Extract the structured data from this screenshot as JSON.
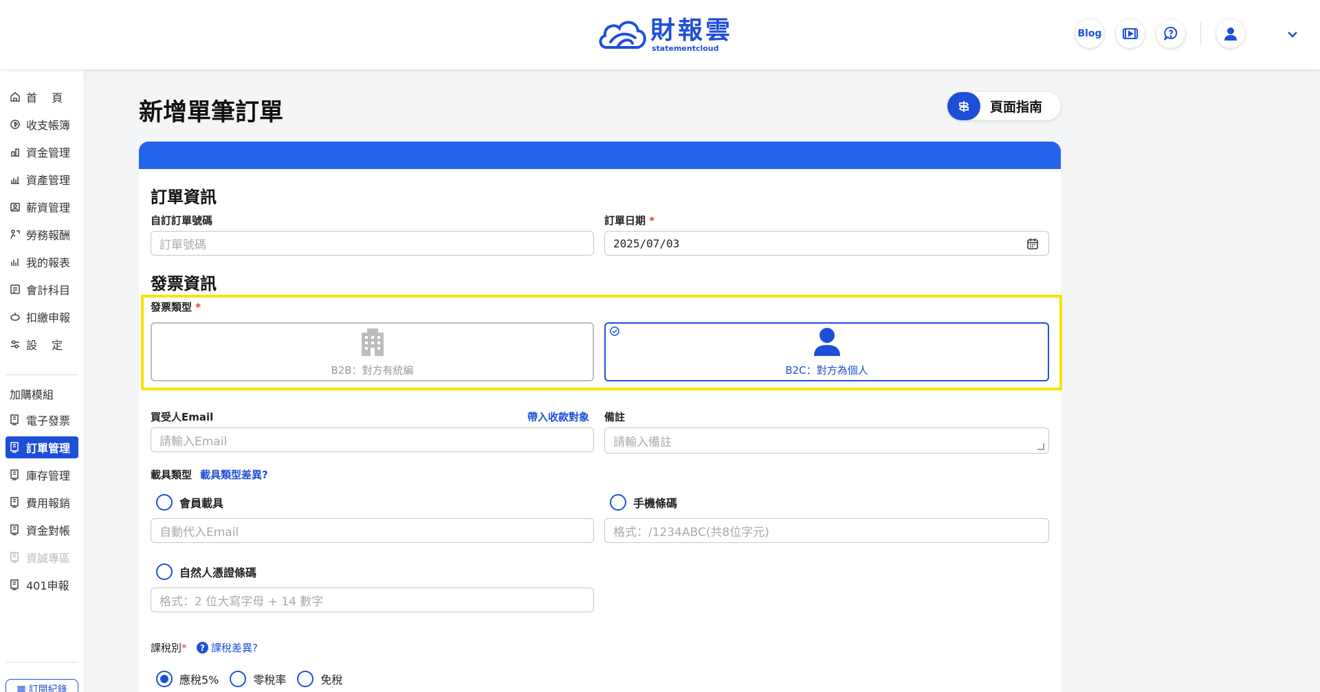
{
  "header": {
    "logo_text": "財報雲",
    "logo_sub": "statementcloud",
    "blog_label": "Blog",
    "icons": [
      "video-icon",
      "help-chat-icon",
      "user-avatar-icon",
      "chevron-down-icon"
    ]
  },
  "sidebar": {
    "items": [
      {
        "label": "首　 頁",
        "icon": "home-icon"
      },
      {
        "label": "收支帳簿",
        "icon": "money-icon"
      },
      {
        "label": "資金管理",
        "icon": "fund-icon"
      },
      {
        "label": "資產管理",
        "icon": "asset-icon"
      },
      {
        "label": "薪資管理",
        "icon": "payroll-icon"
      },
      {
        "label": "勞務報酬",
        "icon": "labor-icon"
      },
      {
        "label": "我的報表",
        "icon": "report-icon"
      },
      {
        "label": "會計科目",
        "icon": "accounts-icon"
      },
      {
        "label": "扣繳申報",
        "icon": "withholding-icon"
      },
      {
        "label": "設　 定",
        "icon": "settings-icon"
      }
    ],
    "addon_title": "加購模組",
    "addons": [
      {
        "label": "電子發票",
        "state": "normal"
      },
      {
        "label": "訂單管理",
        "state": "active"
      },
      {
        "label": "庫存管理",
        "state": "normal"
      },
      {
        "label": "費用報銷",
        "state": "normal"
      },
      {
        "label": "資金對帳",
        "state": "normal"
      },
      {
        "label": "資誠專區",
        "state": "disabled"
      },
      {
        "label": "401申報",
        "state": "normal"
      }
    ],
    "bottom_button": "訂閱紀錄"
  },
  "page": {
    "title": "新增單筆訂單",
    "guide_label": "頁面指南"
  },
  "order_info": {
    "title": "訂單資訊",
    "order_no_label": "自訂訂單號碼",
    "order_no_placeholder": "訂單號碼",
    "date_label": "訂單日期",
    "date_value": "2025/07/03"
  },
  "invoice_info": {
    "title": "發票資訊",
    "type_label": "發票類型",
    "b2b_label": "B2B：對方有統編",
    "b2c_label": "B2C：對方為個人",
    "selected": "B2C",
    "email_label": "買受人Email",
    "import_link": "帶入收款對象",
    "email_placeholder": "請輸入Email",
    "note_label": "備註",
    "note_placeholder": "請輸入備註",
    "carrier_label": "載具類型",
    "carrier_link": "載具類型差異?",
    "carrier_member": "會員載具",
    "carrier_member_placeholder": "自動代入Email",
    "carrier_mobile": "手機條碼",
    "carrier_mobile_placeholder": "格式：/1234ABC(共8位字元)",
    "carrier_cert": "自然人憑證條碼",
    "carrier_cert_placeholder": "格式：2 位大寫字母 + 14 數字",
    "tax_label": "課稅別",
    "tax_link": "課稅差異?",
    "tax_options": [
      "應稅5%",
      "零稅率",
      "免稅"
    ],
    "tax_selected": "應稅5%"
  },
  "colors": {
    "accent": "#1e4fd8",
    "card_header": "#2563eb",
    "highlight": "#f5e400",
    "required": "#e53935"
  }
}
